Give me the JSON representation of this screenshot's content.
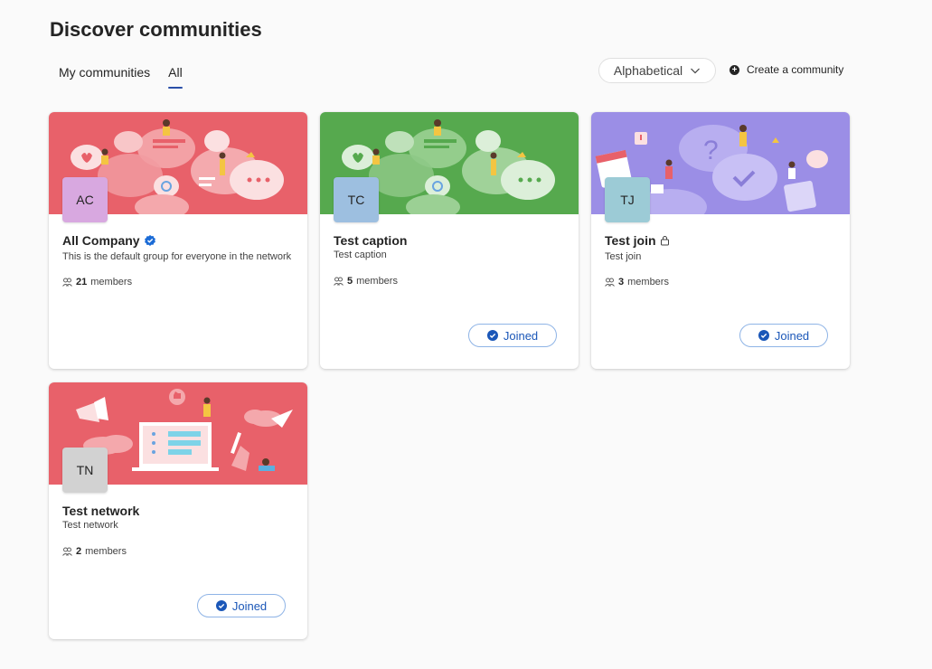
{
  "page": {
    "title": "Discover communities"
  },
  "tabs": [
    {
      "label": "My communities"
    },
    {
      "label": "All"
    }
  ],
  "sort": {
    "label": "Alphabetical"
  },
  "create": {
    "label": "Create a community"
  },
  "cards": [
    {
      "initials": "AC",
      "name": "All Company",
      "description": "This is the default group for everyone in the network",
      "member_count": "21",
      "member_label": "members",
      "joined_label": ""
    },
    {
      "initials": "TC",
      "name": "Test caption",
      "description": "Test caption",
      "member_count": "5",
      "member_label": "members",
      "joined_label": "Joined"
    },
    {
      "initials": "TJ",
      "name": "Test join",
      "description": "Test join",
      "member_count": "3",
      "member_label": "members",
      "joined_label": "Joined"
    },
    {
      "initials": "TN",
      "name": "Test network",
      "description": "Test network",
      "member_count": "2",
      "member_label": "members",
      "joined_label": "Joined"
    }
  ],
  "colors": {
    "red_banner": "#e8616a",
    "green_banner": "#56a94e",
    "purple_banner": "#9b8ee6",
    "accent": "#1b57b8",
    "avatar_ac": "#d8a8e0",
    "avatar_tc": "#9dbfe0",
    "avatar_tj": "#9ccbd6",
    "avatar_tn": "#d2d2d2"
  }
}
